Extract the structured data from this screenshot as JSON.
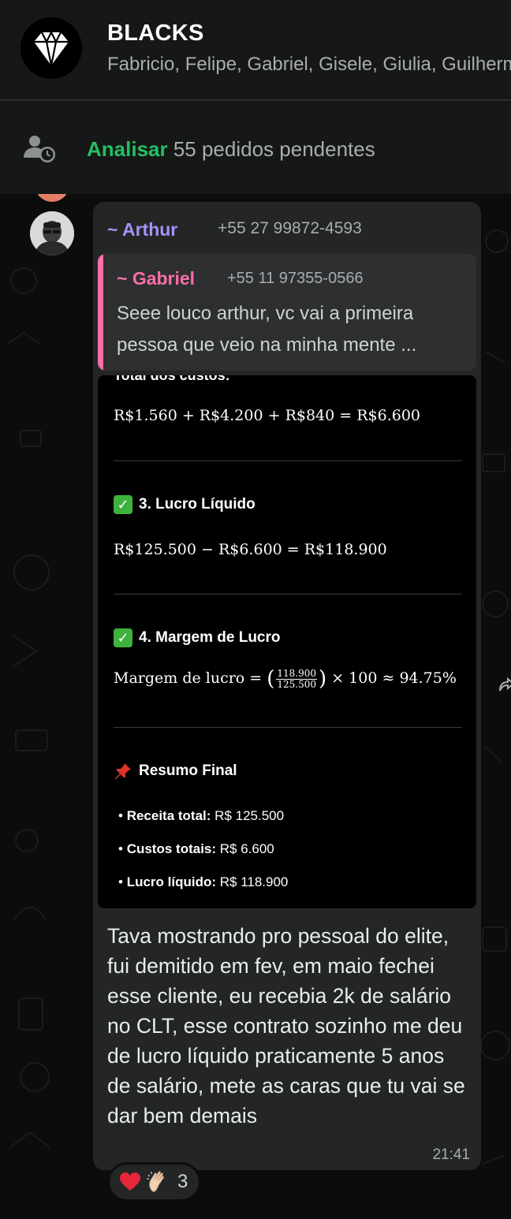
{
  "header": {
    "group_name": "BLACKS",
    "members": "Fabricio, Felipe, Gabriel, Gisele, Giulia, Guilherme"
  },
  "pending": {
    "link_label": "Analisar",
    "text": " 55 pedidos pendentes"
  },
  "message": {
    "sender_name": "~ Arthur",
    "sender_phone": "+55 27 99872-4593",
    "quote": {
      "name": "~ Gabriel",
      "phone": "+55 11 97355-0566",
      "text": "Seee louco arthur, vc vai a primeira pessoa que veio na minha mente ..."
    },
    "screenshot": {
      "cut_heading": "Total dos custos:",
      "costs_equation": "R$1.560 + R$4.200 + R$840 = R$6.600",
      "section3_title": "3. Lucro Líquido",
      "profit_equation": "R$125.500 − R$6.600 = R$118.900",
      "section4_title": "4. Margem de Lucro",
      "margin_label": "Margem de lucro = ",
      "margin_numerator": "118.900",
      "margin_denominator": "125.500",
      "margin_result": " × 100 ≈ 94.75%",
      "summary_title": "Resumo Final",
      "bullets": [
        {
          "label": "Receita total:",
          "value": " R$ 125.500"
        },
        {
          "label": "Custos totais:",
          "value": " R$ 6.600"
        },
        {
          "label": "Lucro líquido:",
          "value": " R$ 118.900"
        }
      ]
    },
    "body": "Tava mostrando pro pessoal do elite, fui demitido em fev, em maio fechei esse cliente, eu recebia 2k de salário no CLT, esse contrato sozinho me deu de lucro líquido praticamente 5 anos de salário, mete as caras que tu vai se dar bem demais",
    "time": "21:41",
    "reactions": {
      "emojis": [
        "heart",
        "clapping-hands"
      ],
      "count": "3"
    }
  },
  "colors": {
    "accent_green": "#21c063",
    "sender_purple": "#a790f7",
    "quote_pink": "#fb6dab",
    "bubble": "#242626"
  }
}
